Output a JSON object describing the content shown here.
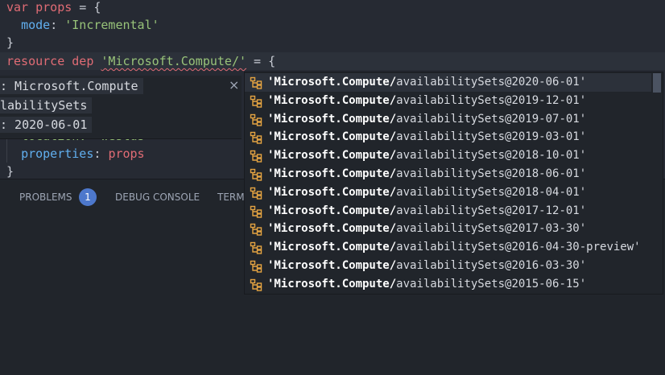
{
  "editor": {
    "line1": {
      "kw": "var",
      "name": "props",
      "eq": " = {"
    },
    "line2": {
      "key": "mode",
      "colon": ": ",
      "value": "'Incremental'"
    },
    "line3": "}",
    "line4": {
      "kw": "resource",
      "name": "dep",
      "value": "'Microsoft.Compute/'",
      "tail": " = {"
    },
    "line_loc": "location: 'westus'",
    "line_props": {
      "key": "properties",
      "colon": ": ",
      "value": "props"
    },
    "line_close": "}"
  },
  "hover": {
    "namespace": ": Microsoft.Compute",
    "type": "labilitySets",
    "version": ": 2020-06-01",
    "close": "×"
  },
  "panel": {
    "tabs": {
      "problems": "PROBLEMS",
      "problems_count": "1",
      "debug": "DEBUG CONSOLE",
      "terminal": "TERMINAL"
    }
  },
  "suggest": {
    "icon": "resource-type-icon",
    "icon_color": "#e5a442",
    "items": [
      {
        "prefix": "'Microsoft.Compute/",
        "rest": "availabilitySets@2020-06-01'"
      },
      {
        "prefix": "'Microsoft.Compute/",
        "rest": "availabilitySets@2019-12-01'"
      },
      {
        "prefix": "'Microsoft.Compute/",
        "rest": "availabilitySets@2019-07-01'"
      },
      {
        "prefix": "'Microsoft.Compute/",
        "rest": "availabilitySets@2019-03-01'"
      },
      {
        "prefix": "'Microsoft.Compute/",
        "rest": "availabilitySets@2018-10-01'"
      },
      {
        "prefix": "'Microsoft.Compute/",
        "rest": "availabilitySets@2018-06-01'"
      },
      {
        "prefix": "'Microsoft.Compute/",
        "rest": "availabilitySets@2018-04-01'"
      },
      {
        "prefix": "'Microsoft.Compute/",
        "rest": "availabilitySets@2017-12-01'"
      },
      {
        "prefix": "'Microsoft.Compute/",
        "rest": "availabilitySets@2017-03-30'"
      },
      {
        "prefix": "'Microsoft.Compute/",
        "rest": "availabilitySets@2016-04-30-preview'"
      },
      {
        "prefix": "'Microsoft.Compute/",
        "rest": "availabilitySets@2016-03-30'"
      },
      {
        "prefix": "'Microsoft.Compute/",
        "rest": "availabilitySets@2015-06-15'"
      }
    ]
  }
}
